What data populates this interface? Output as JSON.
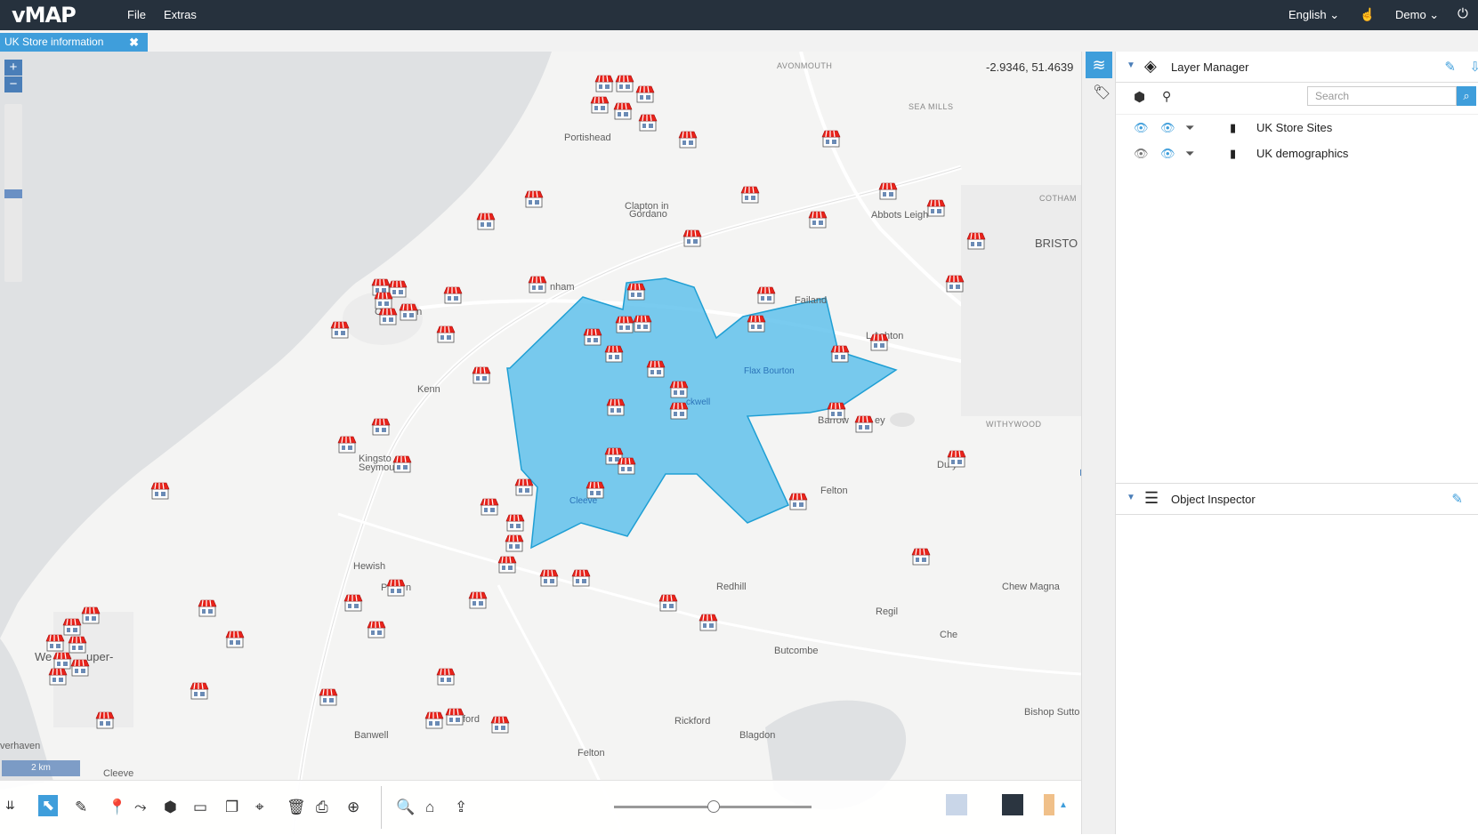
{
  "app": {
    "logo": "vMAP"
  },
  "menu": {
    "file": "File",
    "extras": "Extras"
  },
  "header": {
    "language": "English ⌄",
    "user": "Demo ⌄"
  },
  "tab": {
    "label": "UK Store information",
    "close": "✖"
  },
  "map": {
    "coordinates": "-2.9346, 51.4639",
    "scale": "2 km",
    "zoom_in": "+",
    "zoom_out": "−",
    "labels": {
      "avonmouth": "AVONMOUTH",
      "sea_mills": "SEA MILLS",
      "portishead": "Portishead",
      "clapton": "Clapton in",
      "gordano": "Gordano",
      "abbots_leigh": "Abbots Leigh",
      "cotham": "COTHAM",
      "bristol": "BRISTO",
      "nailsea": "nham",
      "clevedon": "Cl",
      "clevedon2": "on",
      "failand": "Failand",
      "long_ashton": "L   Ashton",
      "flax_bourton": "Flax Bourton",
      "backwell": "ckwell",
      "kenn": "Kenn",
      "barrow": "Barrow",
      "barrow2": "ey",
      "withywood": "WITHYWOOD",
      "kingston": "Kingsto",
      "seymour": "Seymou",
      "dundry": "Du    y",
      "felton": "Felton",
      "cleeve": "Cleeve",
      "hewish": "Hewish",
      "puxton": "P",
      "puxton2": "n",
      "redhill": "Redhill",
      "chew_magna": "Chew Magna",
      "regil": "Regil",
      "we": "We",
      "uper": "uper-",
      "chew": "Che",
      "butcombe": "Butcombe",
      "bishop_sutton": "Bishop Sutto",
      "rickford": "Rickford",
      "banwell": "Banwell",
      "blagdon": "Blagdon",
      "ford": "ford",
      "felton2": "Felton",
      "cleeve2": "Cleeve",
      "everhaven": "verhaven"
    },
    "store_count": 68
  },
  "layer_manager": {
    "title": "Layer Manager",
    "search_placeholder": "Search",
    "layers": [
      {
        "name": "UK Store Sites",
        "visible": true
      },
      {
        "name": "UK demographics",
        "visible": false
      }
    ]
  },
  "object_inspector": {
    "title": "Object Inspector"
  },
  "colors": {
    "accent": "#3f9edb",
    "topbar": "#26313d",
    "polygon": "#5bc0ec",
    "store_roof": "#e8231b"
  },
  "icons": {
    "toolbar": [
      "expand-icon",
      "select-icon",
      "eraser-icon",
      "point-icon",
      "line-icon",
      "polygon-icon",
      "measure-icon",
      "copy-icon",
      "map-pin-icon",
      "delete-icon",
      "print-icon",
      "zoom-icon",
      "search-icon",
      "home-icon",
      "share-icon"
    ]
  }
}
